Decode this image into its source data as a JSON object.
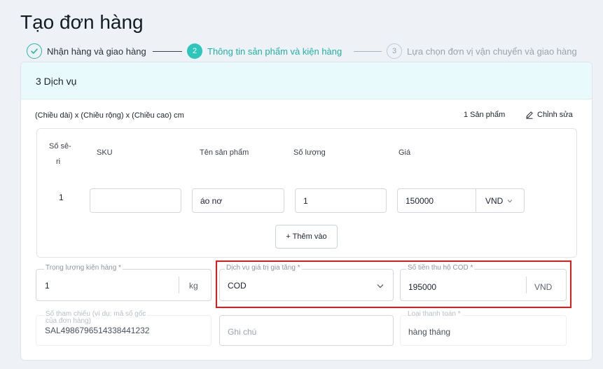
{
  "page": {
    "title": "Tạo đơn hàng"
  },
  "stepper": [
    {
      "number": "",
      "label": "Nhận hàng và giao hàng",
      "state": "done"
    },
    {
      "number": "2",
      "label": "Thông tin sản phẩm và kiện hàng",
      "state": "active"
    },
    {
      "number": "3",
      "label": "Lựa chọn đơn vị vận chuyển và giao hàng",
      "state": "pending"
    }
  ],
  "card": {
    "title": "3 Dịch vụ",
    "dimensions": "(Chiều dài) x (Chiều rộng) x (Chiều cao) cm",
    "product_count": "1 Sản phẩm",
    "edit_label": "Chỉnh sửa"
  },
  "table": {
    "headers": {
      "serial_line1": "Số sê-",
      "serial_line2": "ri",
      "sku": "SKU",
      "name": "Tên sản phẩm",
      "qty": "Số lượng",
      "price": "Giá"
    },
    "rows": [
      {
        "serial": "1",
        "sku": "",
        "name": "áo nơ",
        "qty": "1",
        "price": "150000",
        "currency": "VND"
      }
    ],
    "add_label": "+ Thêm vào"
  },
  "fields": {
    "weight": {
      "label": "Trọng lượng kiện hàng *",
      "value": "1",
      "unit": "kg"
    },
    "service": {
      "label": "Dịch vụ giá trị gia tăng *",
      "value": "COD"
    },
    "cod_amount": {
      "label": "Số tiền thu hộ COD *",
      "value": "195000",
      "unit": "VND"
    },
    "reference": {
      "label_line1": "Số tham chiếu (ví dụ: mã số gốc",
      "label_line2": "của đơn hàng)",
      "value": "SAL498679651433844123​2"
    },
    "note": {
      "placeholder": "Ghi chú"
    },
    "payment": {
      "label": "Loại thanh toán *",
      "value": "hàng tháng"
    }
  },
  "colors": {
    "accent": "#2cc6bb",
    "highlight": "#e01a1a",
    "header_bg": "#e8fafb"
  }
}
